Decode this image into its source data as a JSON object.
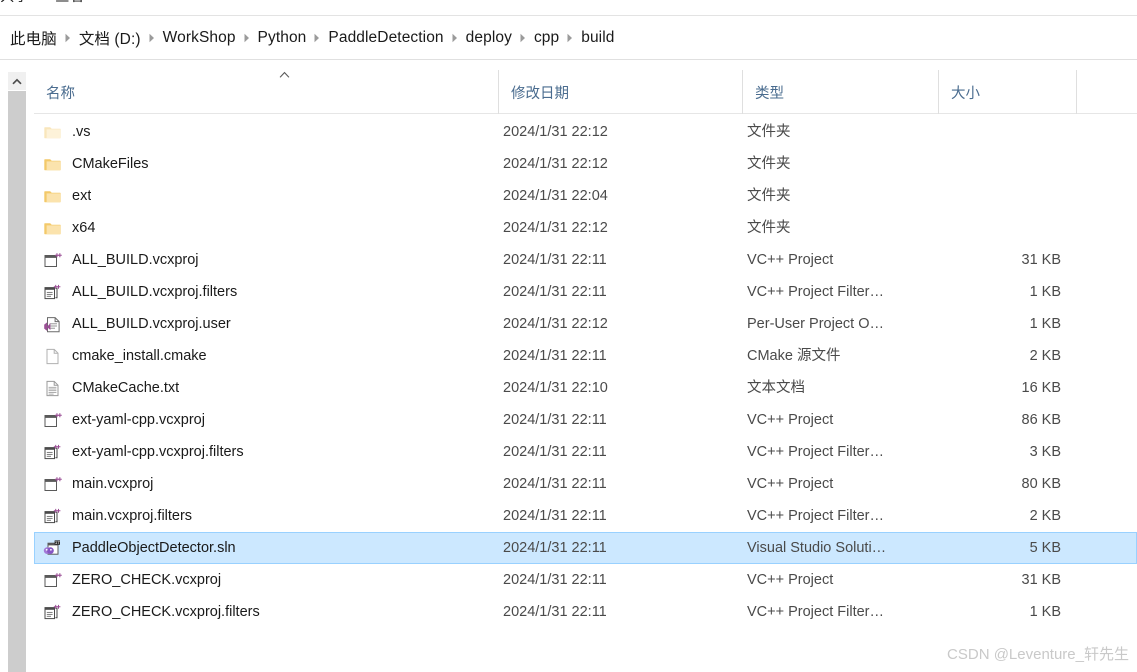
{
  "ribbon": {
    "tabs": [
      {
        "label": "共享"
      },
      {
        "label": "查看"
      }
    ]
  },
  "address": {
    "separator_icon": "chevron-right-icon",
    "crumbs": [
      {
        "label": "此电脑"
      },
      {
        "label": "文档 (D:)"
      },
      {
        "label": "WorkShop"
      },
      {
        "label": "Python"
      },
      {
        "label": "PaddleDetection"
      },
      {
        "label": "deploy"
      },
      {
        "label": "cpp"
      },
      {
        "label": "build"
      }
    ]
  },
  "columns": {
    "name": "名称",
    "date": "修改日期",
    "type": "类型",
    "size": "大小",
    "sort_icon": "caret-up-icon",
    "sort_column": "名称",
    "sort_direction": "ascending"
  },
  "scrollbar": {
    "up_icon": "chevron-up-icon"
  },
  "colors": {
    "selection_bg": "#cce8ff",
    "selection_border": "#99d1ff",
    "header_text": "#4a6c8f",
    "folder": "#f7d793",
    "vs_purple": "#9b4f96"
  },
  "rows": [
    {
      "name": ".vs",
      "date": "2024/1/31 22:12",
      "type": "文件夹",
      "size": "",
      "icon": "folder-icon",
      "hidden": true,
      "selected": false
    },
    {
      "name": "CMakeFiles",
      "date": "2024/1/31 22:12",
      "type": "文件夹",
      "size": "",
      "icon": "folder-icon",
      "hidden": false,
      "selected": false
    },
    {
      "name": "ext",
      "date": "2024/1/31 22:04",
      "type": "文件夹",
      "size": "",
      "icon": "folder-icon",
      "hidden": false,
      "selected": false
    },
    {
      "name": "x64",
      "date": "2024/1/31 22:12",
      "type": "文件夹",
      "size": "",
      "icon": "folder-icon",
      "hidden": false,
      "selected": false
    },
    {
      "name": "ALL_BUILD.vcxproj",
      "date": "2024/1/31 22:11",
      "type": "VC++ Project",
      "size": "31 KB",
      "icon": "vcxproj-icon",
      "hidden": false,
      "selected": false
    },
    {
      "name": "ALL_BUILD.vcxproj.filters",
      "date": "2024/1/31 22:11",
      "type": "VC++ Project Filter…",
      "size": "1 KB",
      "icon": "filters-icon",
      "hidden": false,
      "selected": false
    },
    {
      "name": "ALL_BUILD.vcxproj.user",
      "date": "2024/1/31 22:12",
      "type": "Per-User Project O…",
      "size": "1 KB",
      "icon": "vsuser-icon",
      "hidden": false,
      "selected": false
    },
    {
      "name": "cmake_install.cmake",
      "date": "2024/1/31 22:11",
      "type": "CMake 源文件",
      "size": "2 KB",
      "icon": "document-icon",
      "hidden": false,
      "selected": false
    },
    {
      "name": "CMakeCache.txt",
      "date": "2024/1/31 22:10",
      "type": "文本文档",
      "size": "16 KB",
      "icon": "text-icon",
      "hidden": false,
      "selected": false
    },
    {
      "name": "ext-yaml-cpp.vcxproj",
      "date": "2024/1/31 22:11",
      "type": "VC++ Project",
      "size": "86 KB",
      "icon": "vcxproj-icon",
      "hidden": false,
      "selected": false
    },
    {
      "name": "ext-yaml-cpp.vcxproj.filters",
      "date": "2024/1/31 22:11",
      "type": "VC++ Project Filter…",
      "size": "3 KB",
      "icon": "filters-icon",
      "hidden": false,
      "selected": false
    },
    {
      "name": "main.vcxproj",
      "date": "2024/1/31 22:11",
      "type": "VC++ Project",
      "size": "80 KB",
      "icon": "vcxproj-icon",
      "hidden": false,
      "selected": false
    },
    {
      "name": "main.vcxproj.filters",
      "date": "2024/1/31 22:11",
      "type": "VC++ Project Filter…",
      "size": "2 KB",
      "icon": "filters-icon",
      "hidden": false,
      "selected": false
    },
    {
      "name": "PaddleObjectDetector.sln",
      "date": "2024/1/31 22:11",
      "type": "Visual Studio Soluti…",
      "size": "5 KB",
      "icon": "sln-icon",
      "hidden": false,
      "selected": true
    },
    {
      "name": "ZERO_CHECK.vcxproj",
      "date": "2024/1/31 22:11",
      "type": "VC++ Project",
      "size": "31 KB",
      "icon": "vcxproj-icon",
      "hidden": false,
      "selected": false
    },
    {
      "name": "ZERO_CHECK.vcxproj.filters",
      "date": "2024/1/31 22:11",
      "type": "VC++ Project Filter…",
      "size": "1 KB",
      "icon": "filters-icon",
      "hidden": false,
      "selected": false
    }
  ],
  "watermark": {
    "text": "CSDN @Leventure_轩先生"
  }
}
